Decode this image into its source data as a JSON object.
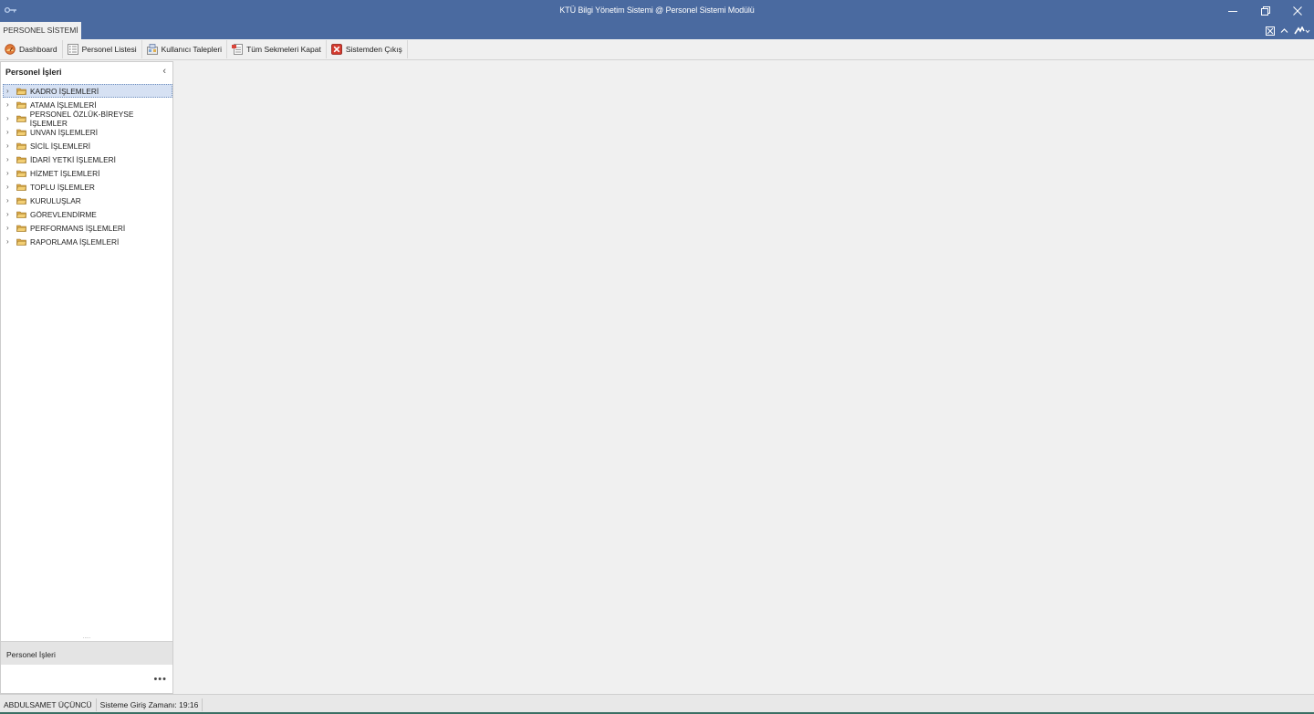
{
  "window": {
    "title": "KTÜ Bilgi Yönetim Sistemi @ Personel Sistemi Modülü",
    "controls": {
      "minimize": "—",
      "restore": "❐",
      "close": "✕"
    }
  },
  "ribbon": {
    "tab_label": "PERSONEL SİSTEMİ",
    "right_icons": [
      "fullscreen-icon",
      "collapse-ribbon-icon",
      "skin-menu-icon"
    ]
  },
  "toolbar": {
    "items": [
      {
        "label": "Dashboard",
        "icon": "dashboard-icon"
      },
      {
        "label": "Personel Listesi",
        "icon": "list-icon"
      },
      {
        "label": "Kullanıcı Talepleri",
        "icon": "requests-icon"
      },
      {
        "label": "Tüm Sekmeleri Kapat",
        "icon": "close-tabs-icon"
      },
      {
        "label": "Sistemden Çıkış",
        "icon": "exit-icon"
      }
    ]
  },
  "nav": {
    "title": "Personel İşleri",
    "collapse_glyph": "‹",
    "items": [
      {
        "label": "KADRO İŞLEMLERİ"
      },
      {
        "label": "ATAMA İŞLEMLERİ"
      },
      {
        "label": "PERSONEL ÖZLÜK-BİREYSE İŞLEMLER"
      },
      {
        "label": "UNVAN İŞLEMLERİ"
      },
      {
        "label": "SİCİL İŞLEMLERİ"
      },
      {
        "label": "İDARİ YETKİ İŞLEMLERİ"
      },
      {
        "label": "HİZMET İŞLEMLERİ"
      },
      {
        "label": "TOPLU İŞLEMLER"
      },
      {
        "label": "KURULUŞLAR"
      },
      {
        "label": "GÖREVLENDİRME"
      },
      {
        "label": "PERFORMANS İŞLEMLERİ"
      },
      {
        "label": "RAPORLAMA İŞLEMLERİ"
      }
    ],
    "selected_index": 0,
    "group_label": "Personel İşleri",
    "more_glyph": "•••"
  },
  "status": {
    "user": "ABDULSAMET ÜÇÜNCÜ",
    "login_time": "Sisteme Giriş Zamanı: 19:16"
  },
  "colors": {
    "titlebar": "#4a6aa0",
    "selection": "#d6e1f3",
    "folder": "#d9a645",
    "status_accent": "#3b6f64"
  }
}
